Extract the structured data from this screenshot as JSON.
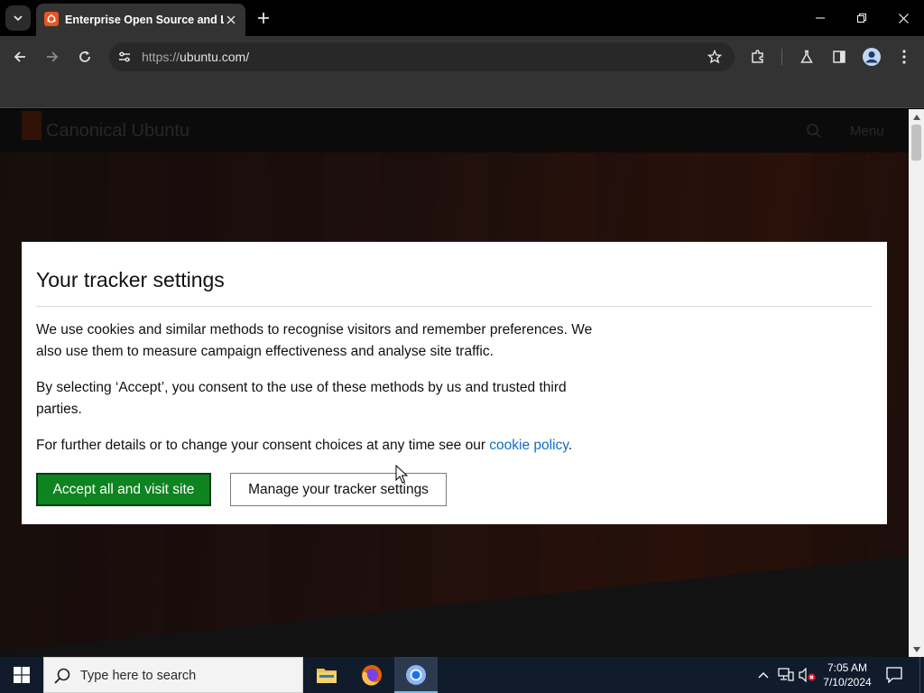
{
  "browser": {
    "tab": {
      "title": "Enterprise Open Source and Linux | Ubuntu"
    },
    "address": {
      "scheme": "https://",
      "host": "ubuntu.com/"
    }
  },
  "site": {
    "brand": "Canonical Ubuntu",
    "menu_label": "Menu"
  },
  "consent": {
    "title": "Your tracker settings",
    "para1": "We use cookies and similar methods to recognise visitors and remember preferences. We also use them to measure campaign effectiveness and analyse site traffic.",
    "para2": "By selecting ‘Accept’, you consent to the use of these methods by us and trusted third parties.",
    "para3_prefix": "For further details or to change your consent choices at any time see our ",
    "para3_link": "cookie policy",
    "para3_suffix": ".",
    "accept_label": "Accept all and visit site",
    "manage_label": "Manage your tracker settings"
  },
  "taskbar": {
    "search_placeholder": "Type here to search",
    "time": "7:05 AM",
    "date": "7/10/2024"
  },
  "colors": {
    "accent_green": "#0e8420",
    "link_blue": "#0e6ec7",
    "ubuntu_orange": "#e95420"
  }
}
